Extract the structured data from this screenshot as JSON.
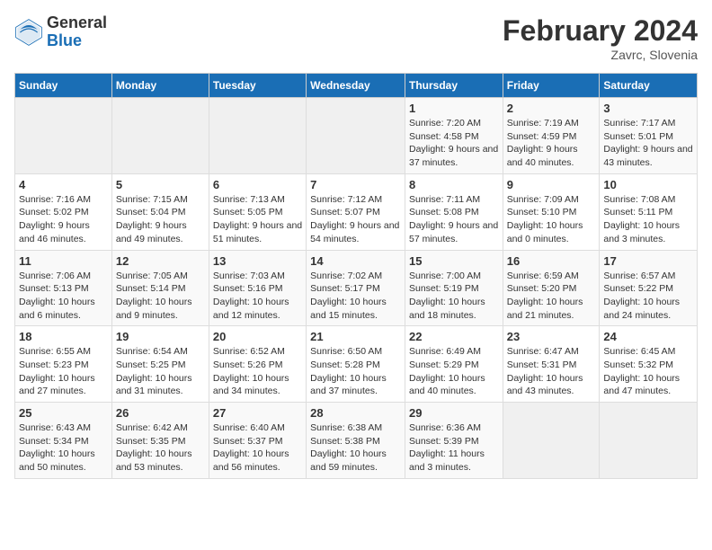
{
  "header": {
    "logo_general": "General",
    "logo_blue": "Blue",
    "title": "February 2024",
    "subtitle": "Zavrc, Slovenia"
  },
  "calendar": {
    "days_of_week": [
      "Sunday",
      "Monday",
      "Tuesday",
      "Wednesday",
      "Thursday",
      "Friday",
      "Saturday"
    ],
    "weeks": [
      [
        {
          "day": "",
          "info": ""
        },
        {
          "day": "",
          "info": ""
        },
        {
          "day": "",
          "info": ""
        },
        {
          "day": "",
          "info": ""
        },
        {
          "day": "1",
          "info": "Sunrise: 7:20 AM\nSunset: 4:58 PM\nDaylight: 9 hours and 37 minutes."
        },
        {
          "day": "2",
          "info": "Sunrise: 7:19 AM\nSunset: 4:59 PM\nDaylight: 9 hours and 40 minutes."
        },
        {
          "day": "3",
          "info": "Sunrise: 7:17 AM\nSunset: 5:01 PM\nDaylight: 9 hours and 43 minutes."
        }
      ],
      [
        {
          "day": "4",
          "info": "Sunrise: 7:16 AM\nSunset: 5:02 PM\nDaylight: 9 hours and 46 minutes."
        },
        {
          "day": "5",
          "info": "Sunrise: 7:15 AM\nSunset: 5:04 PM\nDaylight: 9 hours and 49 minutes."
        },
        {
          "day": "6",
          "info": "Sunrise: 7:13 AM\nSunset: 5:05 PM\nDaylight: 9 hours and 51 minutes."
        },
        {
          "day": "7",
          "info": "Sunrise: 7:12 AM\nSunset: 5:07 PM\nDaylight: 9 hours and 54 minutes."
        },
        {
          "day": "8",
          "info": "Sunrise: 7:11 AM\nSunset: 5:08 PM\nDaylight: 9 hours and 57 minutes."
        },
        {
          "day": "9",
          "info": "Sunrise: 7:09 AM\nSunset: 5:10 PM\nDaylight: 10 hours and 0 minutes."
        },
        {
          "day": "10",
          "info": "Sunrise: 7:08 AM\nSunset: 5:11 PM\nDaylight: 10 hours and 3 minutes."
        }
      ],
      [
        {
          "day": "11",
          "info": "Sunrise: 7:06 AM\nSunset: 5:13 PM\nDaylight: 10 hours and 6 minutes."
        },
        {
          "day": "12",
          "info": "Sunrise: 7:05 AM\nSunset: 5:14 PM\nDaylight: 10 hours and 9 minutes."
        },
        {
          "day": "13",
          "info": "Sunrise: 7:03 AM\nSunset: 5:16 PM\nDaylight: 10 hours and 12 minutes."
        },
        {
          "day": "14",
          "info": "Sunrise: 7:02 AM\nSunset: 5:17 PM\nDaylight: 10 hours and 15 minutes."
        },
        {
          "day": "15",
          "info": "Sunrise: 7:00 AM\nSunset: 5:19 PM\nDaylight: 10 hours and 18 minutes."
        },
        {
          "day": "16",
          "info": "Sunrise: 6:59 AM\nSunset: 5:20 PM\nDaylight: 10 hours and 21 minutes."
        },
        {
          "day": "17",
          "info": "Sunrise: 6:57 AM\nSunset: 5:22 PM\nDaylight: 10 hours and 24 minutes."
        }
      ],
      [
        {
          "day": "18",
          "info": "Sunrise: 6:55 AM\nSunset: 5:23 PM\nDaylight: 10 hours and 27 minutes."
        },
        {
          "day": "19",
          "info": "Sunrise: 6:54 AM\nSunset: 5:25 PM\nDaylight: 10 hours and 31 minutes."
        },
        {
          "day": "20",
          "info": "Sunrise: 6:52 AM\nSunset: 5:26 PM\nDaylight: 10 hours and 34 minutes."
        },
        {
          "day": "21",
          "info": "Sunrise: 6:50 AM\nSunset: 5:28 PM\nDaylight: 10 hours and 37 minutes."
        },
        {
          "day": "22",
          "info": "Sunrise: 6:49 AM\nSunset: 5:29 PM\nDaylight: 10 hours and 40 minutes."
        },
        {
          "day": "23",
          "info": "Sunrise: 6:47 AM\nSunset: 5:31 PM\nDaylight: 10 hours and 43 minutes."
        },
        {
          "day": "24",
          "info": "Sunrise: 6:45 AM\nSunset: 5:32 PM\nDaylight: 10 hours and 47 minutes."
        }
      ],
      [
        {
          "day": "25",
          "info": "Sunrise: 6:43 AM\nSunset: 5:34 PM\nDaylight: 10 hours and 50 minutes."
        },
        {
          "day": "26",
          "info": "Sunrise: 6:42 AM\nSunset: 5:35 PM\nDaylight: 10 hours and 53 minutes."
        },
        {
          "day": "27",
          "info": "Sunrise: 6:40 AM\nSunset: 5:37 PM\nDaylight: 10 hours and 56 minutes."
        },
        {
          "day": "28",
          "info": "Sunrise: 6:38 AM\nSunset: 5:38 PM\nDaylight: 10 hours and 59 minutes."
        },
        {
          "day": "29",
          "info": "Sunrise: 6:36 AM\nSunset: 5:39 PM\nDaylight: 11 hours and 3 minutes."
        },
        {
          "day": "",
          "info": ""
        },
        {
          "day": "",
          "info": ""
        }
      ]
    ]
  }
}
